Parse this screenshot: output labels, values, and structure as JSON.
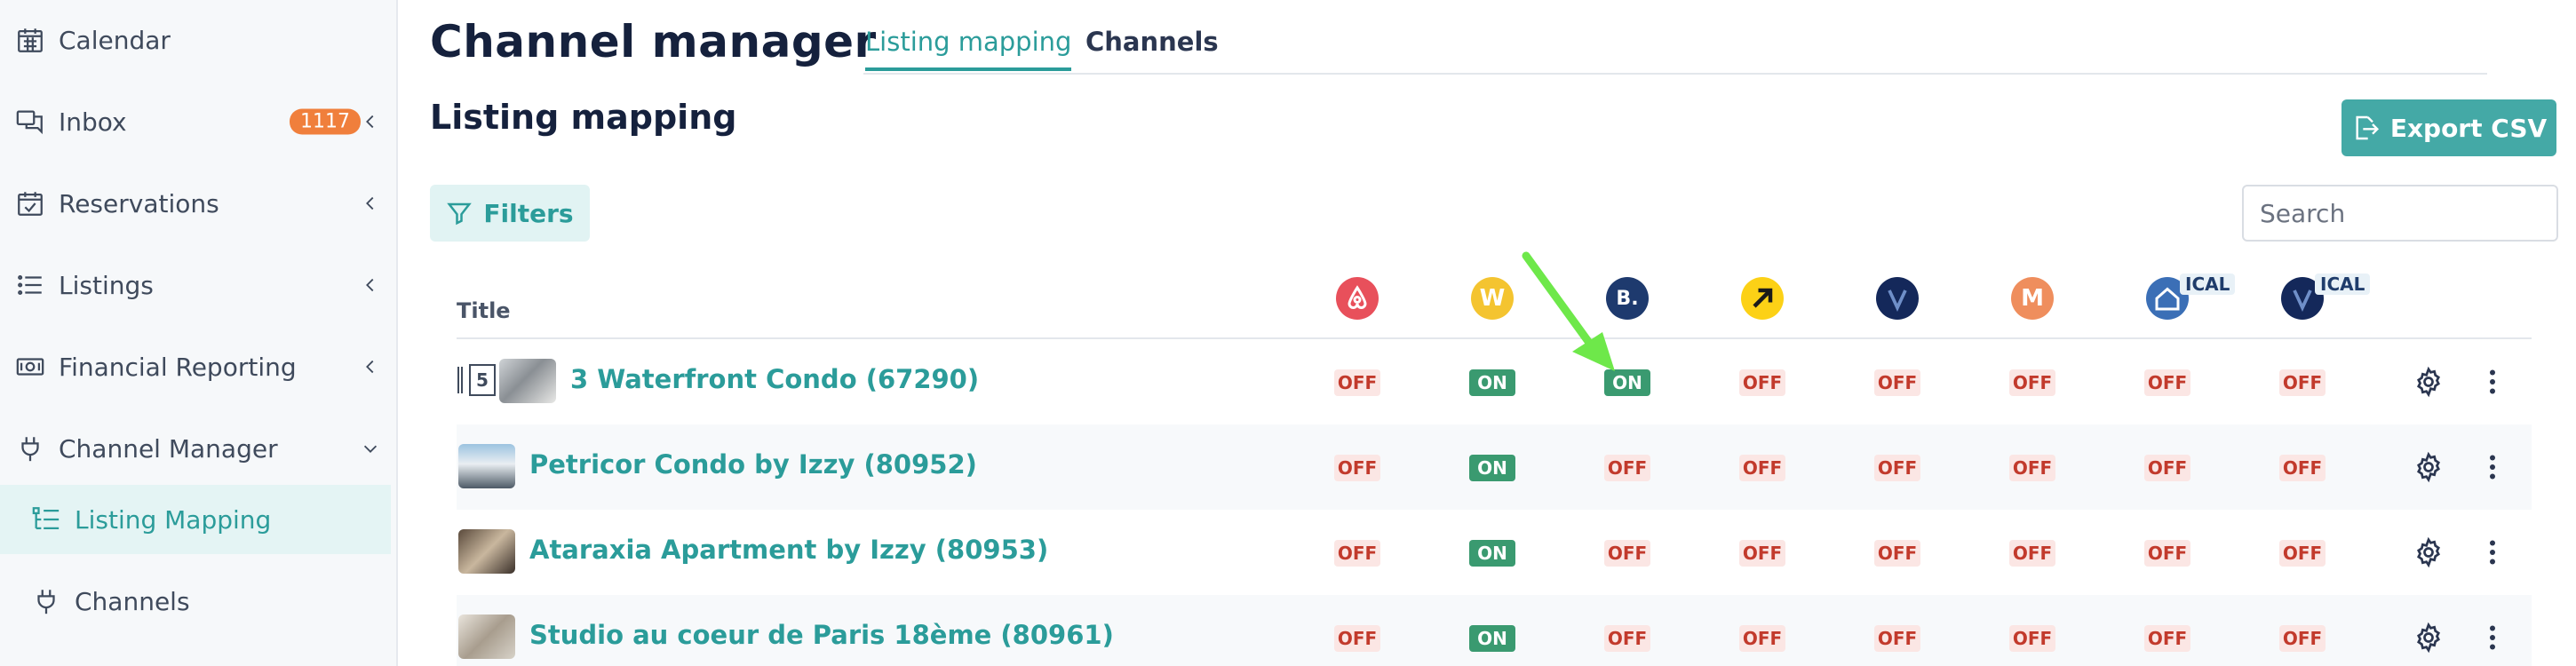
{
  "sidebar": {
    "items": [
      {
        "label": "Calendar",
        "icon": "calendar-icon"
      },
      {
        "label": "Inbox",
        "icon": "chat-icon",
        "badge": "1117"
      },
      {
        "label": "Reservations",
        "icon": "reservations-icon"
      },
      {
        "label": "Listings",
        "icon": "list-icon"
      },
      {
        "label": "Financial Reporting",
        "icon": "money-icon"
      },
      {
        "label": "Channel Manager",
        "icon": "plug-icon"
      }
    ],
    "sub_items": [
      {
        "label": "Listing Mapping",
        "icon": "listing-mapping-icon",
        "active": true
      },
      {
        "label": "Channels",
        "icon": "plug-icon",
        "active": false
      }
    ]
  },
  "header": {
    "title": "Channel manager",
    "tabs": [
      {
        "label": "Listing mapping",
        "active": true
      },
      {
        "label": "Channels",
        "active": false
      }
    ]
  },
  "main": {
    "section_title": "Listing mapping",
    "export_label": "Export CSV",
    "filters_label": "Filters",
    "search_placeholder": "Search"
  },
  "table": {
    "title_header": "Title",
    "channels": [
      {
        "icon": "airbnb-icon",
        "color": "#e8505b"
      },
      {
        "icon": "w-channel-icon",
        "color": "#f4c430",
        "letter": "W"
      },
      {
        "icon": "booking-icon",
        "color": "#1e3a6e",
        "letter": "B."
      },
      {
        "icon": "expedia-icon",
        "color": "#fcd116"
      },
      {
        "icon": "vrbo-icon",
        "color": "#14285a"
      },
      {
        "icon": "m-channel-icon",
        "color": "#ef8e5d",
        "letter": "M"
      },
      {
        "icon": "ical-home-icon",
        "color": "#3b6fb6",
        "tag": "ICAL"
      },
      {
        "icon": "ical-vrbo-icon",
        "color": "#14285a",
        "tag": "ICAL"
      }
    ],
    "rows": [
      {
        "title": "3 Waterfront Condo (67290)",
        "count": "5",
        "statuses": [
          "OFF",
          "ON",
          "ON",
          "OFF",
          "OFF",
          "OFF",
          "OFF",
          "OFF"
        ]
      },
      {
        "title": "Petricor Condo by Izzy (80952)",
        "statuses": [
          "OFF",
          "ON",
          "OFF",
          "OFF",
          "OFF",
          "OFF",
          "OFF",
          "OFF"
        ]
      },
      {
        "title": "Ataraxia Apartment by Izzy (80953)",
        "statuses": [
          "OFF",
          "ON",
          "OFF",
          "OFF",
          "OFF",
          "OFF",
          "OFF",
          "OFF"
        ]
      },
      {
        "title": "Studio au coeur de Paris 18ème (80961)",
        "statuses": [
          "OFF",
          "ON",
          "OFF",
          "OFF",
          "OFF",
          "OFF",
          "OFF",
          "OFF"
        ]
      }
    ]
  },
  "colors": {
    "accent": "#2b9c9a",
    "export_bg": "#44a9a6",
    "on": "#3a9a70",
    "off_text": "#c23a2c",
    "off_bg": "#fbe6e4",
    "badge": "#f07f3c",
    "arrow": "#6ee84a"
  }
}
